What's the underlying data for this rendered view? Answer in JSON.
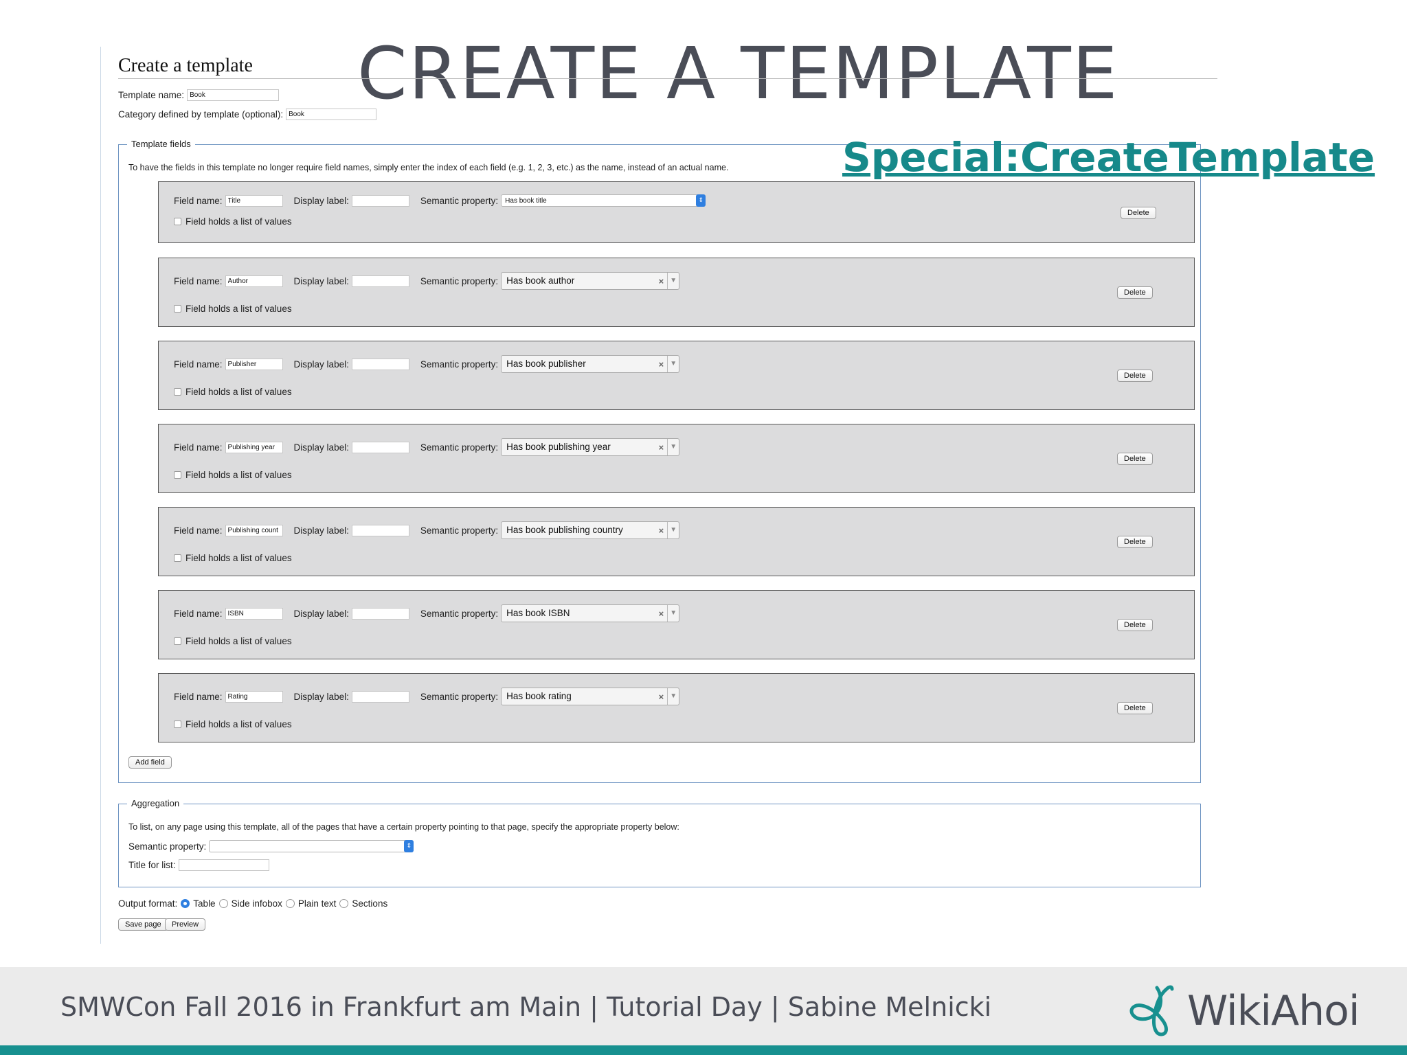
{
  "slide": {
    "title": "CREATE A TEMPLATE",
    "special_link": "Special:CreateTemplate"
  },
  "page": {
    "title": "Create a template",
    "template_name_label": "Template name:",
    "template_name_value": "Book",
    "category_label": "Category defined by template (optional):",
    "category_value": "Book"
  },
  "template_fields": {
    "legend": "Template fields",
    "hint": "To have the fields in this template no longer require field names, simply enter the index of each field (e.g. 1, 2, 3, etc.) as the name, instead of an actual name.",
    "field_name_label": "Field name:",
    "display_label_label": "Display label:",
    "semantic_property_label": "Semantic property:",
    "list_checkbox_label": "Field holds a list of values",
    "delete_label": "Delete",
    "fields": [
      {
        "name": "Title",
        "property": "Has book title"
      },
      {
        "name": "Author",
        "property": "Has book author"
      },
      {
        "name": "Publisher",
        "property": "Has book publisher"
      },
      {
        "name": "Publishing year",
        "property": "Has book publishing year"
      },
      {
        "name": "Publishing count",
        "property": "Has book publishing country"
      },
      {
        "name": "ISBN",
        "property": "Has book ISBN"
      },
      {
        "name": "Rating",
        "property": "Has book rating"
      }
    ],
    "add_field_label": "Add field"
  },
  "aggregation": {
    "legend": "Aggregation",
    "hint": "To list, on any page using this template, all of the pages that have a certain property pointing to that page, specify the appropriate property below:",
    "semantic_property_label": "Semantic property:",
    "semantic_property_value": "",
    "title_for_list_label": "Title for list:",
    "title_for_list_value": ""
  },
  "output": {
    "label": "Output format:",
    "options": [
      "Table",
      "Side infobox",
      "Plain text",
      "Sections"
    ],
    "selected": "Table"
  },
  "actions": {
    "save_label": "Save page",
    "preview_label": "Preview"
  },
  "footer": {
    "text": "SMWCon Fall 2016 in Frankfurt am Main | Tutorial Day | Sabine Melnicki",
    "brand": "WikiAhoi"
  },
  "colors": {
    "accent": "#16898a",
    "title_gray": "#4a4d57",
    "fieldset_border": "#6f95c2",
    "field_box_bg": "#dcdcdd",
    "select_blue": "#2f7fe0"
  }
}
